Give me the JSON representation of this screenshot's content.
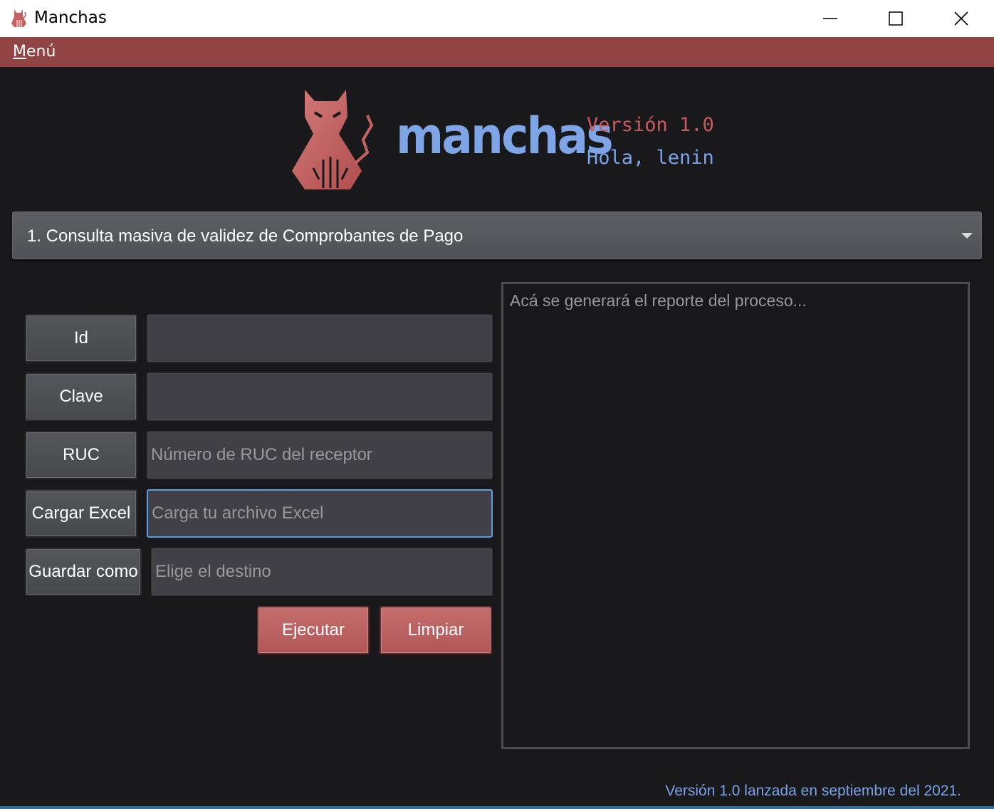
{
  "window": {
    "title": "Manchas",
    "app_icon": "cat-icon",
    "controls": [
      "minimize-icon",
      "maximize-icon",
      "close-icon"
    ]
  },
  "menubar": {
    "menu_label_first": "M",
    "menu_label_rest": "enú"
  },
  "header": {
    "logo_word": "manchas",
    "version": "Versión 1.0",
    "greeting": "Hola, lenin"
  },
  "process_select": {
    "selected": "1. Consulta masiva de validez de Comprobantes de Pago"
  },
  "form": {
    "id_label": "Id",
    "id_value": "",
    "clave_label": "Clave",
    "clave_value": "",
    "ruc_label": "RUC",
    "ruc_placeholder": "Número de RUC del receptor",
    "excel_label": "Cargar Excel",
    "excel_placeholder": "Carga tu archivo Excel",
    "save_label": "Guardar como",
    "save_placeholder": "Elige el destino",
    "run_label": "Ejecutar",
    "clear_label": "Limpiar"
  },
  "report": {
    "placeholder": "Acá se generará el reporte del proceso..."
  },
  "footer": {
    "text": "Versión 1.0 lanzada en septiembre del 2021."
  },
  "colors": {
    "accent_red": "#924444",
    "button_red": "#b95f5f",
    "accent_blue": "#79a4ea",
    "background": "#19191c",
    "focus_blue": "#5b9ee8"
  }
}
